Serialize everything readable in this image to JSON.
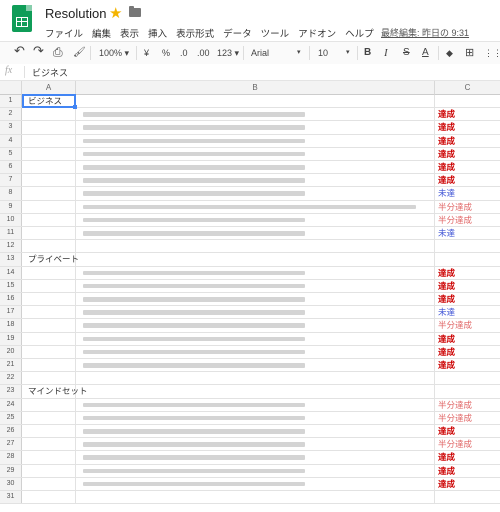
{
  "doc": {
    "title": "Resolution",
    "star_icon": "star-icon",
    "folder_icon": "folder-icon"
  },
  "menu": [
    "ファイル",
    "編集",
    "表示",
    "挿入",
    "表示形式",
    "データ",
    "ツール",
    "アドオン",
    "ヘルプ"
  ],
  "last_edit": "最終編集: 昨日の 9:31",
  "toolbar": {
    "undo": "↶",
    "redo": "↷",
    "print": "⎙",
    "paint": "🖌",
    "zoom": "100% ▾",
    "currency": "¥",
    "percent": "%",
    "dec_decrease": ".0",
    "dec_increase": ".00",
    "format": "123 ▾",
    "font": "Arial",
    "font_arrow": "▾",
    "size": "10",
    "size_arrow": "▾",
    "bold": "B",
    "italic": "I",
    "strike": "S",
    "text_color": "A",
    "fill": "◆",
    "borders": "⊞",
    "merge": "⋮⋮"
  },
  "formula": {
    "fx": "fx",
    "value": "ビジネス"
  },
  "columns": [
    "A",
    "B",
    "C"
  ],
  "colors": {
    "red": "#cc0000",
    "orange": "#e06666",
    "blue": "#3d52d5",
    "selection": "#4285f4"
  },
  "rows": [
    {
      "num": "1",
      "a": "ビジネス",
      "bar": 0,
      "c": "",
      "s": ""
    },
    {
      "num": "2",
      "a": "",
      "bar": 0.64,
      "c": "達成",
      "s": "red"
    },
    {
      "num": "3",
      "a": "",
      "bar": 0.64,
      "c": "達成",
      "s": "red"
    },
    {
      "num": "4",
      "a": "",
      "bar": 0.64,
      "c": "達成",
      "s": "red"
    },
    {
      "num": "5",
      "a": "",
      "bar": 0.64,
      "c": "達成",
      "s": "red"
    },
    {
      "num": "6",
      "a": "",
      "bar": 0.64,
      "c": "達成",
      "s": "red"
    },
    {
      "num": "7",
      "a": "",
      "bar": 0.64,
      "c": "達成",
      "s": "red"
    },
    {
      "num": "8",
      "a": "",
      "bar": 0.64,
      "c": "未達",
      "s": "blue"
    },
    {
      "num": "9",
      "a": "",
      "bar": 0.96,
      "c": "半分達成",
      "s": "orange"
    },
    {
      "num": "10",
      "a": "",
      "bar": 0.64,
      "c": "半分達成",
      "s": "orange"
    },
    {
      "num": "11",
      "a": "",
      "bar": 0.64,
      "c": "未達",
      "s": "blue"
    },
    {
      "num": "12",
      "a": "",
      "bar": 0,
      "c": "",
      "s": ""
    },
    {
      "num": "13",
      "a": "プライベート",
      "bar": 0,
      "c": "",
      "s": ""
    },
    {
      "num": "14",
      "a": "",
      "bar": 0.64,
      "c": "達成",
      "s": "red"
    },
    {
      "num": "15",
      "a": "",
      "bar": 0.64,
      "c": "達成",
      "s": "red"
    },
    {
      "num": "16",
      "a": "",
      "bar": 0.64,
      "c": "達成",
      "s": "red"
    },
    {
      "num": "17",
      "a": "",
      "bar": 0.64,
      "c": "未達",
      "s": "blue"
    },
    {
      "num": "18",
      "a": "",
      "bar": 0.64,
      "c": "半分達成",
      "s": "orange"
    },
    {
      "num": "19",
      "a": "",
      "bar": 0.64,
      "c": "達成",
      "s": "red"
    },
    {
      "num": "20",
      "a": "",
      "bar": 0.64,
      "c": "達成",
      "s": "red"
    },
    {
      "num": "21",
      "a": "",
      "bar": 0.64,
      "c": "達成",
      "s": "red"
    },
    {
      "num": "22",
      "a": "",
      "bar": 0,
      "c": "",
      "s": ""
    },
    {
      "num": "23",
      "a": "マインドセット",
      "bar": 0,
      "c": "",
      "s": ""
    },
    {
      "num": "24",
      "a": "",
      "bar": 0.64,
      "c": "半分達成",
      "s": "orange"
    },
    {
      "num": "25",
      "a": "",
      "bar": 0.64,
      "c": "半分達成",
      "s": "orange"
    },
    {
      "num": "26",
      "a": "",
      "bar": 0.64,
      "c": "達成",
      "s": "red"
    },
    {
      "num": "27",
      "a": "",
      "bar": 0.64,
      "c": "半分達成",
      "s": "orange"
    },
    {
      "num": "28",
      "a": "",
      "bar": 0.64,
      "c": "達成",
      "s": "red"
    },
    {
      "num": "29",
      "a": "",
      "bar": 0.64,
      "c": "達成",
      "s": "red"
    },
    {
      "num": "30",
      "a": "",
      "bar": 0.64,
      "c": "達成",
      "s": "red"
    },
    {
      "num": "31",
      "a": "",
      "bar": 0,
      "c": "",
      "s": ""
    }
  ]
}
